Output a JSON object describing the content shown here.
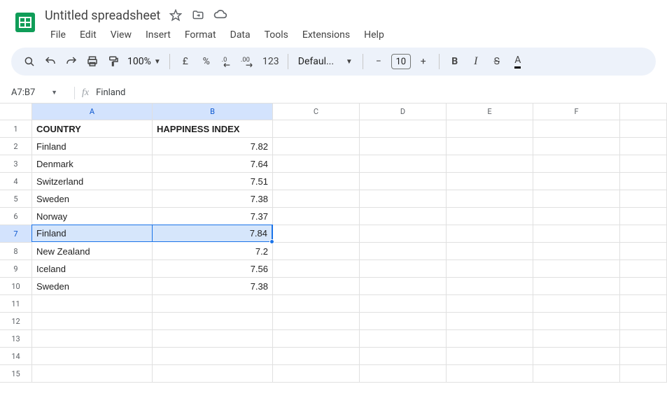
{
  "header": {
    "doc_title": "Untitled spreadsheet",
    "menus": [
      "File",
      "Edit",
      "View",
      "Insert",
      "Format",
      "Data",
      "Tools",
      "Extensions",
      "Help"
    ]
  },
  "toolbar": {
    "zoom": "100%",
    "currency": "£",
    "percent": "%",
    "decrease_dec": ".0",
    "increase_dec": ".00",
    "numfmt": "123",
    "font_family": "Defaul...",
    "minus": "−",
    "font_size": "10",
    "plus": "+",
    "bold": "B",
    "italic": "I",
    "strike": "S",
    "textcolor": "A"
  },
  "formula_bar": {
    "name_box": "A7:B7",
    "fx": "fx",
    "formula": "Finland"
  },
  "sheet": {
    "columns": [
      "A",
      "B",
      "C",
      "D",
      "E",
      "F",
      ""
    ],
    "selected_cols": [
      0,
      1
    ],
    "selected_row": 7,
    "rows": [
      {
        "n": 1,
        "A": "COUNTRY",
        "B": "HAPPINESS INDEX",
        "bold": true
      },
      {
        "n": 2,
        "A": "Finland",
        "B": "7.82"
      },
      {
        "n": 3,
        "A": "Denmark",
        "B": "7.64"
      },
      {
        "n": 4,
        "A": "Switzerland",
        "B": "7.51"
      },
      {
        "n": 5,
        "A": "Sweden",
        "B": "7.38"
      },
      {
        "n": 6,
        "A": "Norway",
        "B": "7.37"
      },
      {
        "n": 7,
        "A": "Finland",
        "B": "7.84",
        "selected": true
      },
      {
        "n": 8,
        "A": "New Zealand",
        "B": "7.2"
      },
      {
        "n": 9,
        "A": "Iceland",
        "B": "7.56"
      },
      {
        "n": 10,
        "A": "Sweden",
        "B": "7.38"
      },
      {
        "n": 11,
        "A": "",
        "B": ""
      },
      {
        "n": 12,
        "A": "",
        "B": ""
      },
      {
        "n": 13,
        "A": "",
        "B": ""
      },
      {
        "n": 14,
        "A": "",
        "B": ""
      },
      {
        "n": 15,
        "A": "",
        "B": ""
      }
    ]
  }
}
